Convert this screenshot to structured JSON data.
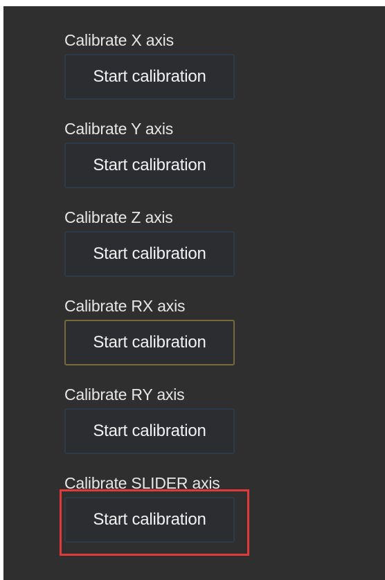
{
  "axes": [
    {
      "label": "Calibrate X axis",
      "button_label": "Start calibration"
    },
    {
      "label": "Calibrate Y axis",
      "button_label": "Start calibration"
    },
    {
      "label": "Calibrate Z axis",
      "button_label": "Start calibration"
    },
    {
      "label": "Calibrate RX axis",
      "button_label": "Start calibration"
    },
    {
      "label": "Calibrate RY axis",
      "button_label": "Start calibration"
    },
    {
      "label": "Calibrate SLIDER axis",
      "button_label": "Start calibration"
    }
  ],
  "colors": {
    "background": "#2f2f2f",
    "text": "#e6e6e6",
    "button_border": "#2d3a48",
    "focused_border": "#7a6a3a",
    "highlight": "#e03a3a"
  }
}
